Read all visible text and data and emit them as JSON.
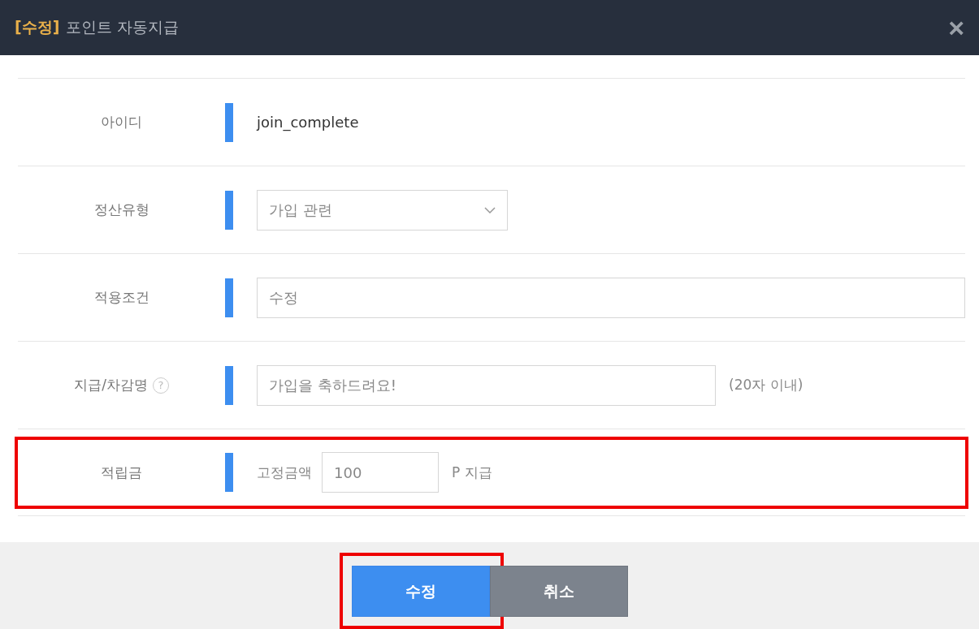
{
  "window": {
    "title_tag": "[수정]",
    "title": "포인트 자동지급",
    "close": "×"
  },
  "rows": [
    {
      "kind": "text",
      "label": "아이디",
      "value": "join_complete",
      "highlighted": false
    },
    {
      "kind": "select",
      "label": "정산유형",
      "value": "가입 관련",
      "highlighted": false
    },
    {
      "kind": "input",
      "label": "적용조건",
      "value": "수정",
      "highlighted": false
    },
    {
      "kind": "note_input",
      "label": "지급/차감명",
      "help": "?",
      "value": "가입을 축하드려요!",
      "note": "(20자 이내)",
      "highlighted": false
    },
    {
      "kind": "amount",
      "label": "적립금",
      "prefix": "고정금액",
      "value": "100",
      "suffix": "P 지급",
      "highlighted": true
    }
  ],
  "buttons": [
    {
      "kind": "primary",
      "label": "수정",
      "highlighted": true
    },
    {
      "kind": "secondary",
      "label": "취소",
      "highlighted": false
    }
  ]
}
